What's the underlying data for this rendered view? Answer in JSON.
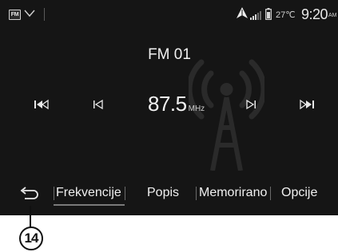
{
  "status_bar": {
    "source_chip": "FM",
    "chevron_icon": "chevron-down-icon",
    "nav_icon": "navigation-arrow-icon",
    "signal_icon": "signal-strength-icon",
    "battery_icon": "battery-icon",
    "temperature": "27℃",
    "time": "9:20",
    "ampm": "AM"
  },
  "radio": {
    "station": "FM 01",
    "frequency": "87.5",
    "unit": "MHz",
    "controls": {
      "seek_back_icon": "skip-previous-icon",
      "step_back_icon": "step-back-icon",
      "step_forward_icon": "step-forward-icon",
      "seek_forward_icon": "skip-next-icon"
    }
  },
  "tabs": [
    {
      "label": "Frekvencije",
      "active": true
    },
    {
      "label": "Popis",
      "active": false
    },
    {
      "label": "Memorirano",
      "active": false
    },
    {
      "label": "Opcije",
      "active": false
    }
  ],
  "back_icon": "back-arrow-icon",
  "callout": {
    "number": "14"
  },
  "colors": {
    "screen_bg": "#151515",
    "text": "#f2f2f2",
    "secondary_text": "#cfcfcf"
  }
}
